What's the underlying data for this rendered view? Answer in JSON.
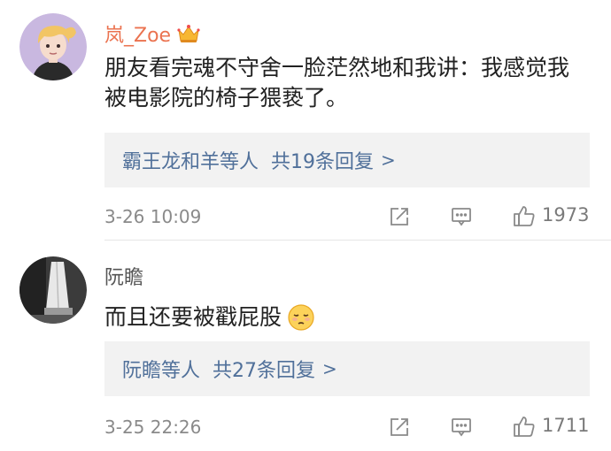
{
  "comments": [
    {
      "username": "岚_Zoe",
      "text": "朋友看完魂不守舍一脸茫然地和我讲：我感觉我被电影院的椅子猥亵了。",
      "reply_names": "霸王龙和羊等人",
      "reply_count": "共19条回复",
      "reply_chevron": ">",
      "timestamp": "3-26 10:09",
      "likes": "1973",
      "icons": {
        "share": "share-icon",
        "comment": "comment-icon",
        "like": "thumbs-up-icon"
      }
    },
    {
      "username": "阮瞻",
      "text": "而且还要被戳屁股",
      "reply_names": "阮瞻等人",
      "reply_count": "共27条回复",
      "reply_chevron": ">",
      "timestamp": "3-25 22:26",
      "likes": "1711",
      "icons": {
        "share": "share-icon",
        "comment": "comment-icon",
        "like": "thumbs-up-icon"
      }
    }
  ],
  "colors": {
    "vip_username": "#eb7350",
    "link": "#50709a",
    "meta": "#8a8a8a",
    "reply_bg": "#f2f2f2"
  }
}
